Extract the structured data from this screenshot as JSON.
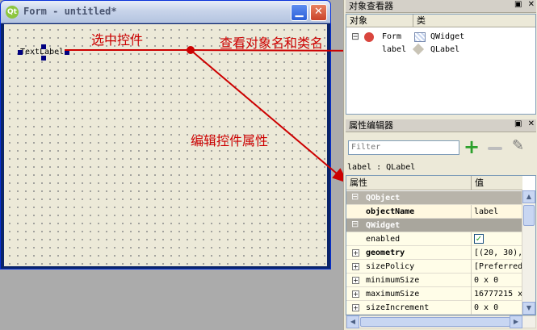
{
  "form": {
    "title": "Form - untitled*",
    "logo": "Qt",
    "minimize": "▁",
    "close": "✕",
    "label_text": "TextLabel"
  },
  "annotations": {
    "select_control": "选中控件",
    "view_names": "查看对象名和类名",
    "edit_properties": "编辑控件属性"
  },
  "object_inspector": {
    "title": "对象查看器",
    "btn_float": "▣",
    "btn_close": "✕",
    "col_object": "对象",
    "col_class": "类",
    "rows": [
      {
        "object": "Form",
        "class": "QWidget",
        "expander": "⊟"
      },
      {
        "object": "label",
        "class": "QLabel"
      }
    ]
  },
  "property_editor": {
    "title": "属性编辑器",
    "btn_float": "▣",
    "btn_close": "✕",
    "filter_placeholder": "Filter",
    "add_icon": "+",
    "config_icon": "✎",
    "object_class": "label : QLabel",
    "col_property": "属性",
    "col_value": "值",
    "groups": [
      {
        "name": "QObject",
        "expander": "⊟"
      },
      {
        "name": "QWidget",
        "expander": "⊟"
      }
    ],
    "properties": [
      {
        "name": "objectName",
        "value": "label"
      },
      {
        "name": "enabled",
        "value": "✓"
      },
      {
        "name": "geometry",
        "value": "[(20, 30),",
        "expander": "+"
      },
      {
        "name": "sizePolicy",
        "value": "[Preferred,",
        "expander": "+"
      },
      {
        "name": "minimumSize",
        "value": "0 x 0",
        "expander": "+"
      },
      {
        "name": "maximumSize",
        "value": "16777215 x",
        "expander": "+"
      },
      {
        "name": "sizeIncrement",
        "value": "0 x 0",
        "expander": "+"
      }
    ]
  },
  "scrollbars": {
    "up": "▲",
    "down": "▼",
    "left": "◀",
    "right": "▶"
  }
}
